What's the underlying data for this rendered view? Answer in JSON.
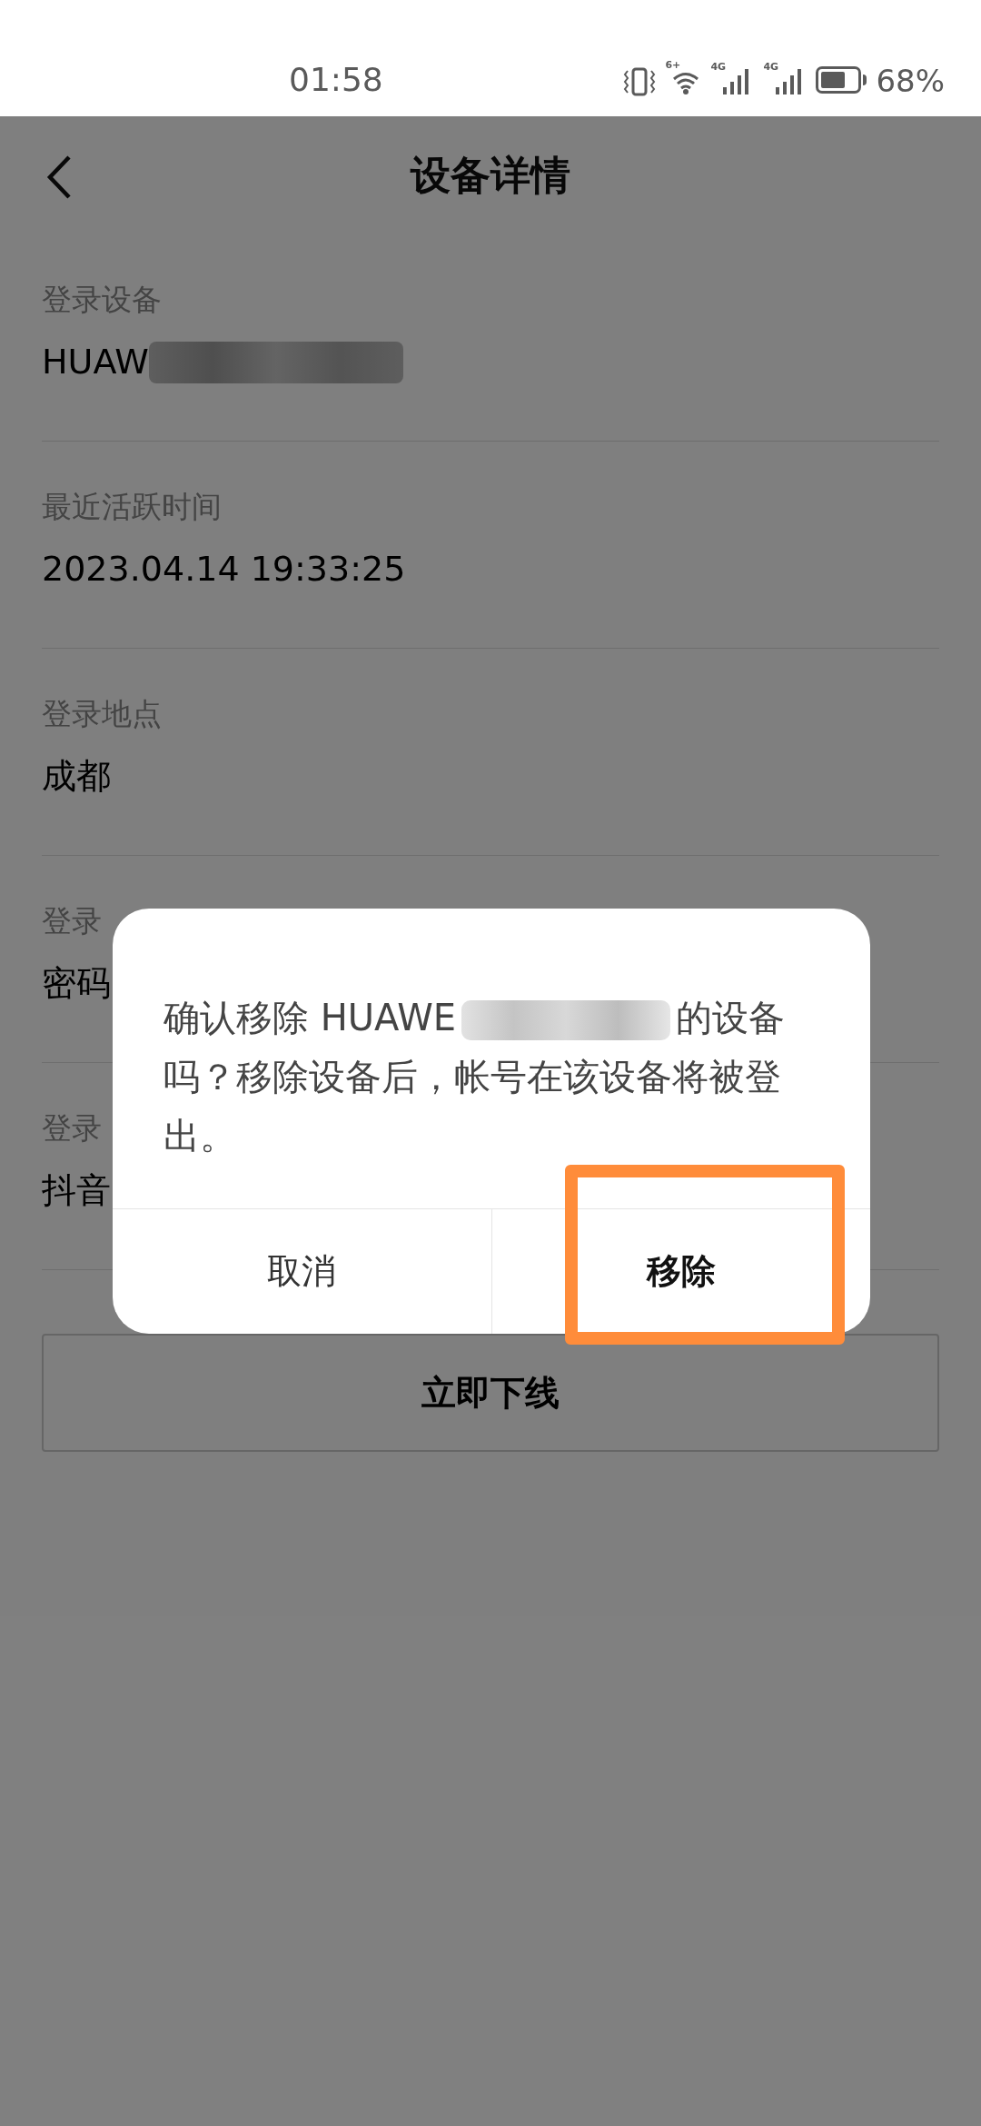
{
  "status_bar": {
    "time": "01:58",
    "wifi_label": "6+",
    "signal_labels": [
      "4G",
      "4G"
    ],
    "battery": "68%"
  },
  "header": {
    "title": "设备详情"
  },
  "fields": [
    {
      "label": "登录设备",
      "value": "HUAW",
      "redacted": true
    },
    {
      "label": "最近活跃时间",
      "value": "2023.04.14 19:33:25",
      "redacted": false
    },
    {
      "label": "登录地点",
      "value": "成都",
      "redacted": false
    },
    {
      "label": "登录",
      "value": "密码",
      "redacted": false
    },
    {
      "label": "登录",
      "value": "抖音",
      "redacted": false
    }
  ],
  "logout_button": "立即下线",
  "dialog": {
    "message_start": "确认移除 HUAWE",
    "redacted": true,
    "message_end": "的设备吗？移除设备后，帐号在该设备将被登出。",
    "buttons": [
      {
        "label": "取消",
        "kind": "cancel",
        "highlighted": false
      },
      {
        "label": "移除",
        "kind": "confirm",
        "highlighted": true
      }
    ]
  }
}
